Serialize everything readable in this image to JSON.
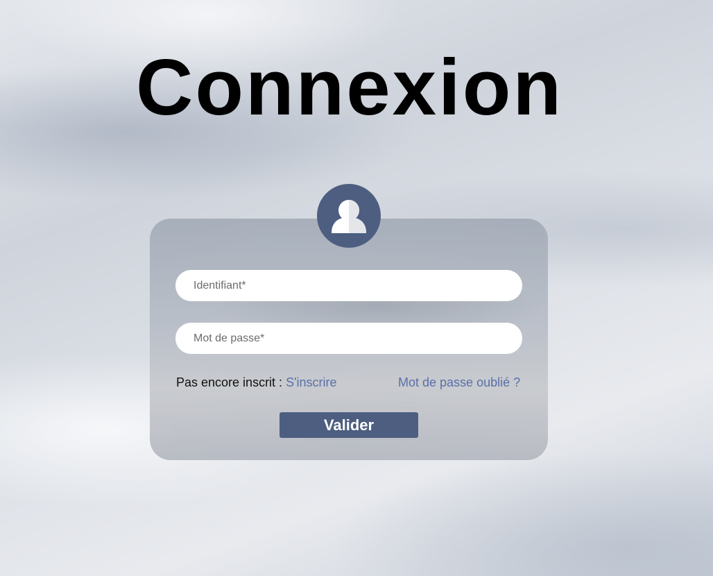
{
  "header": {
    "title": "Connexion"
  },
  "form": {
    "avatar_icon": "user-icon",
    "username_placeholder": "Identifiant*",
    "username_value": "",
    "password_placeholder": "Mot de passe*",
    "password_value": "",
    "register_prompt": "Pas encore inscrit :",
    "register_link": "S'inscrire",
    "forgot_link": "Mot de passe oublié ?",
    "submit_label": "Valider"
  },
  "colors": {
    "accent": "#4d5e80",
    "link": "#5a6fa8",
    "title": "#000000"
  }
}
